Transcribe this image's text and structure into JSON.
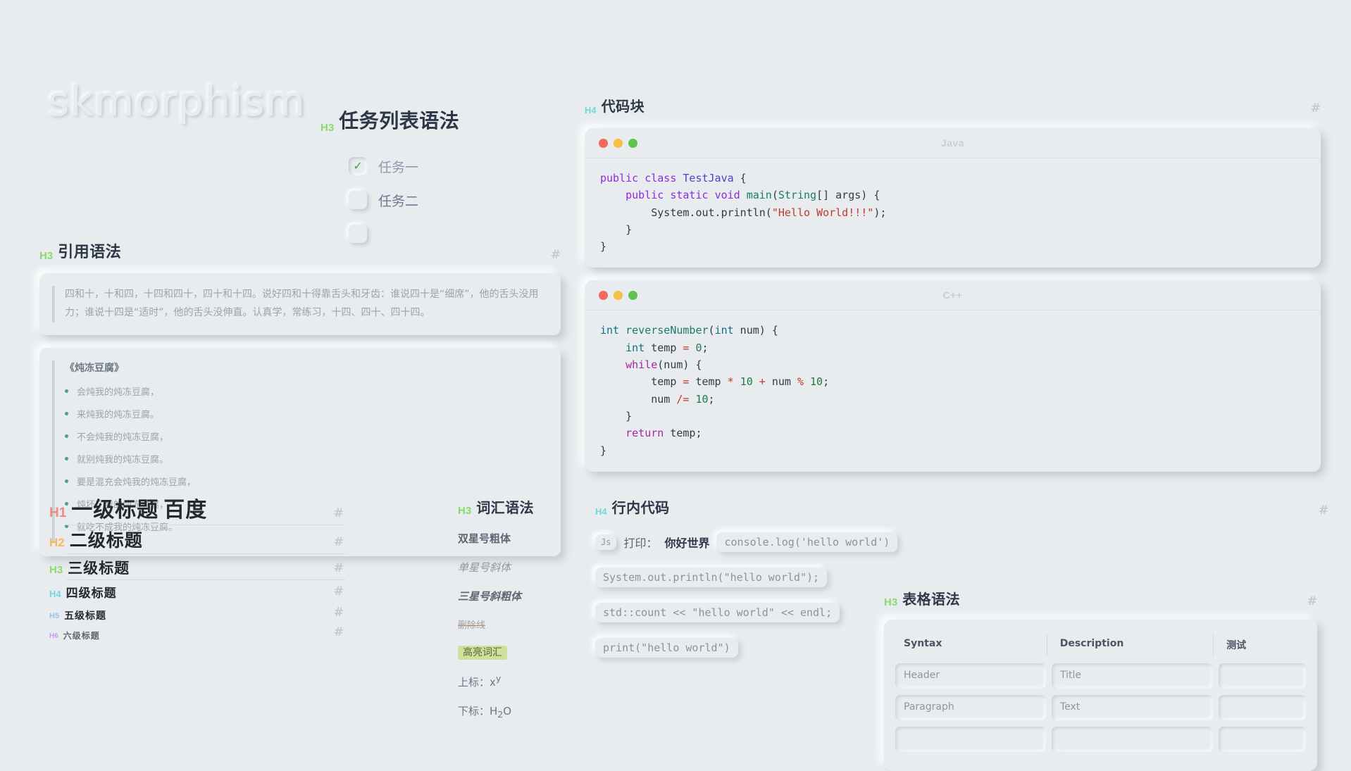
{
  "logo": "skmorphism",
  "anchor_symbol": "#",
  "task_section": {
    "badge": "H3",
    "title": "任务列表语法",
    "items": [
      {
        "label": "任务一",
        "checked": true
      },
      {
        "label": "任务二",
        "checked": false
      },
      {
        "label": "",
        "checked": false
      }
    ]
  },
  "quote_section": {
    "badge": "H3",
    "title": "引用语法",
    "quote": "四和十，十和四，十四和四十，四十和十四。说好四和十得靠舌头和牙齿：谁说四十是“细席”，他的舌头没用力；谁说十四是“适时”，他的舌头没伸直。认真学，常练习，十四、四十、四十四。",
    "list_title": "《炖冻豆腐》",
    "list_items": [
      "会炖我的炖冻豆腐，",
      "来炖我的炖冻豆腐。",
      "不会炖我的炖冻豆腐，",
      "就别炖我的炖冻豆腐。",
      "要是混充会炖我的炖冻豆腐，",
      "炖坏了我的炖冻豆腐，",
      "就吃不成我的炖冻豆腐。"
    ]
  },
  "headings": [
    {
      "badge": "H1",
      "text": "一级标题",
      "link": "百度"
    },
    {
      "badge": "H2",
      "text": "二级标题",
      "link": ""
    },
    {
      "badge": "H3",
      "text": "三级标题",
      "link": ""
    },
    {
      "badge": "H4",
      "text": "四级标题",
      "link": ""
    },
    {
      "badge": "H5",
      "text": "五级标题",
      "link": ""
    },
    {
      "badge": "H6",
      "text": "六级标题",
      "link": ""
    }
  ],
  "vocab_section": {
    "badge": "H3",
    "title": "词汇语法",
    "bold": "双星号粗体",
    "italic": "单星号斜体",
    "bolditalic": "三星号斜粗体",
    "strike": "删除线",
    "mark": "高亮词汇",
    "superscript_label": "上标：",
    "superscript_base": "x",
    "superscript_exp": "y",
    "subscript_label": "下标：",
    "subscript_base_1": "H",
    "subscript_sub": "2",
    "subscript_base_2": "O"
  },
  "codeblock_section": {
    "badge": "H4",
    "title": "代码块",
    "blocks": [
      {
        "lang": "Java",
        "dots": [
          "close-red",
          "minimize-yellow",
          "maximize-green"
        ],
        "lines": [
          "public class TestJava {",
          "    public static void main(String[] args) {",
          "        System.out.println(\"Hello World!!!\");",
          "    }",
          "}"
        ]
      },
      {
        "lang": "C++",
        "dots": [
          "close-red",
          "minimize-yellow",
          "maximize-green"
        ],
        "lines": [
          "int reverseNumber(int num) {",
          "    int temp = 0;",
          "    while(num) {",
          "        temp = temp * 10 + num % 10;",
          "        num /= 10;",
          "    }",
          "    return temp;",
          "}"
        ]
      }
    ]
  },
  "inline_section": {
    "badge": "H4",
    "title": "行内代码",
    "row1_chip": "Js",
    "row1_text_plain": "打印：",
    "row1_text_bold": "你好世界",
    "row1_code": "console.log('hello world')",
    "row2_code": "System.out.println(\"hello world\");",
    "row3_code": "std::count << \"hello world\" << endl;",
    "row4_code": "print(\"hello world\")"
  },
  "table_section": {
    "badge": "H3",
    "title": "表格语法",
    "columns": [
      "Syntax",
      "Description",
      "测试"
    ],
    "rows": [
      [
        "Header",
        "Title",
        ""
      ],
      [
        "Paragraph",
        "Text",
        ""
      ],
      [
        "",
        "",
        ""
      ]
    ]
  },
  "colors": {
    "background": "#e8ecef",
    "h1": "#f08a8a",
    "h2": "#f5b860",
    "h3": "#8ada6e",
    "h4": "#6fd8d8",
    "h5": "#8fc4f0",
    "h6": "#c89af0",
    "link": "#8ecfdc",
    "mark_bg": "#cfe09a",
    "bullet": "#4d9e8c",
    "dot_red": "#f4675c",
    "dot_yellow": "#f7bd45",
    "dot_green": "#5fc44f"
  }
}
